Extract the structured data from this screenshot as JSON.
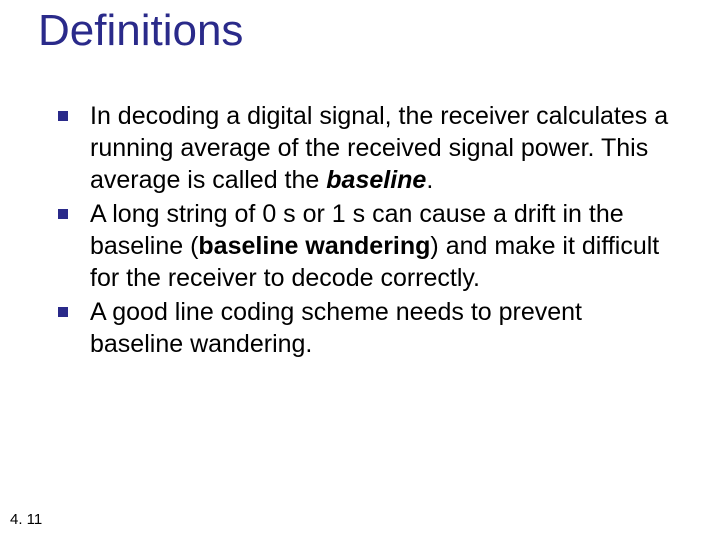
{
  "title": "Definitions",
  "bullets": [
    {
      "pre": "In decoding a digital signal, the receiver calculates a running average of the received signal power. This average is called the ",
      "term": "baseline",
      "post": "."
    },
    {
      "pre": "A long string of 0 s or 1 s can cause a drift in the baseline (",
      "term": "baseline wandering",
      "post": ") and make it difficult for the receiver to decode correctly."
    },
    {
      "pre": "A good line coding scheme needs to prevent baseline wandering.",
      "term": "",
      "post": ""
    }
  ],
  "page_number": "4. 11"
}
